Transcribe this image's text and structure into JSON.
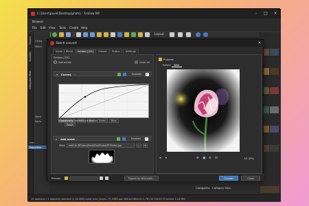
{
  "main_window": {
    "title": "C:\\Users\\pavel\\Desktop\\photo\\ - XnView MP",
    "menu": [
      "Browser",
      "File",
      "Edit",
      "View",
      "Tools",
      "Create",
      "Help"
    ],
    "layout_label": "Layout",
    "left_rail_tabs": [
      "Folders",
      "Favorites",
      "Categories Filter"
    ],
    "left_panel_lines": [
      "Categ",
      "Match",
      "",
      "",
      "",
      "",
      "",
      "",
      "Speci",
      "Ratin"
    ],
    "info_label": "Info",
    "properties_label": "Properties",
    "status_text": "15 object(s) / 1 object(s) selected [1.24 MiB]   rome_man_brudi...75_0983.jpg   3840x2160x24 (1.78)   32.33x33.33 inches   1.24 MiB",
    "right_tabs": [
      "Categories",
      "Category Sets"
    ],
    "colors": {
      "accent": "#3b6fb0",
      "bg_dark": "#2b2b2b"
    }
  },
  "dialog": {
    "title": "Batch convert",
    "tabs": [
      "Input: 1 file(s)",
      "Actions [2/2]",
      "Output",
      "Status",
      "Settings"
    ],
    "active_tab": "Actions [2/2]",
    "actions_heading": "Actions [2/2]",
    "add_action": "Add action",
    "clear_all": "Clear all",
    "curves": {
      "title": "Curves",
      "enabled_label": "Enabled",
      "channels": [
        "Luminosity",
        "RGB",
        "Red",
        "Green",
        "Blue"
      ],
      "active_channel": "Luminosity",
      "hint": "Right click to remove control point",
      "reset": "Reset"
    },
    "mask": {
      "title": "Add mask",
      "enabled_label": "Enabled",
      "label": "Mask",
      "path": "nesP-sh-SH\\Users\\Pavel\\Pbo\\Photos\\PP Photos.jpg",
      "browse": "...",
      "clear": "×"
    },
    "preview": {
      "heading": "Preview",
      "tabs": [
        "Before",
        "After"
      ],
      "active_tab": "After",
      "zoom": "1/1 (8%)",
      "tool_icons": [
        "prev-icon",
        "play-icon",
        "zoom-in-icon",
        "fit-icon",
        "zoom-out-icon",
        "actual-size-icon"
      ]
    },
    "footer": {
      "presets_label": "Presets",
      "export_button": "Export for NConvert...",
      "convert_button": "Convert",
      "close_button": "Close"
    }
  }
}
